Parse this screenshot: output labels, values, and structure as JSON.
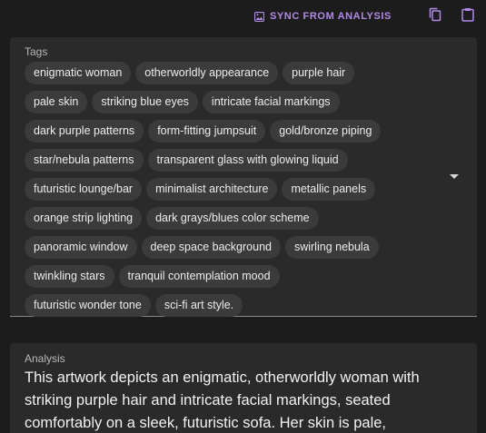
{
  "toolbar": {
    "sync_label": "SYNC FROM ANALYSIS",
    "sync_icon": "sync-image-icon",
    "copy_icon": "copy-icon",
    "paste_icon": "clipboard-icon",
    "accent_color": "#b18ae6"
  },
  "tags": {
    "label": "Tags",
    "rows": [
      [
        "enigmatic woman",
        "otherworldly appearance",
        "purple hair"
      ],
      [
        "pale skin",
        "striking blue eyes",
        "intricate facial markings"
      ],
      [
        "dark purple patterns",
        "form-fitting jumpsuit",
        "gold/bronze piping"
      ],
      [
        "star/nebula patterns",
        "transparent glass with glowing liquid"
      ],
      [
        "futuristic lounge/bar",
        "minimalist architecture",
        "metallic panels"
      ],
      [
        "orange strip lighting",
        "dark grays/blues color scheme"
      ],
      [
        "panoramic window",
        "deep space background",
        "swirling nebula"
      ],
      [
        "twinkling stars",
        "tranquil contemplation mood"
      ],
      [
        "futuristic wonder tone",
        "sci-fi art style."
      ]
    ]
  },
  "analysis": {
    "label": "Analysis",
    "text": "This artwork depicts an enigmatic, otherworldly woman with striking purple hair and intricate facial markings, seated comfortably on a sleek, futuristic sofa. Her skin is pale,"
  }
}
